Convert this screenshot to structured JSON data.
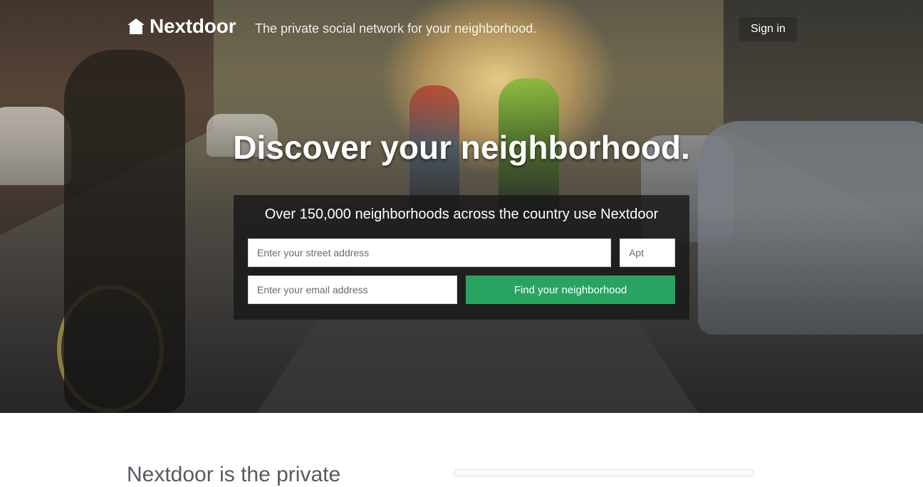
{
  "brand": {
    "name": "Nextdoor",
    "tagline": "The private social network for your neighborhood.",
    "logo_icon": "house-icon"
  },
  "nav": {
    "signin_label": "Sign in"
  },
  "hero": {
    "headline": "Discover your neighborhood.",
    "background": "street-with-cyclists-photo"
  },
  "signup": {
    "title": "Over 150,000 neighborhoods across the country use Nextdoor",
    "street_placeholder": "Enter your street address",
    "apt_placeholder": "Apt",
    "email_placeholder": "Enter your email address",
    "button_label": "Find your neighborhood",
    "button_color": "#29a361"
  },
  "below": {
    "title_partial": "Nextdoor is the private"
  }
}
